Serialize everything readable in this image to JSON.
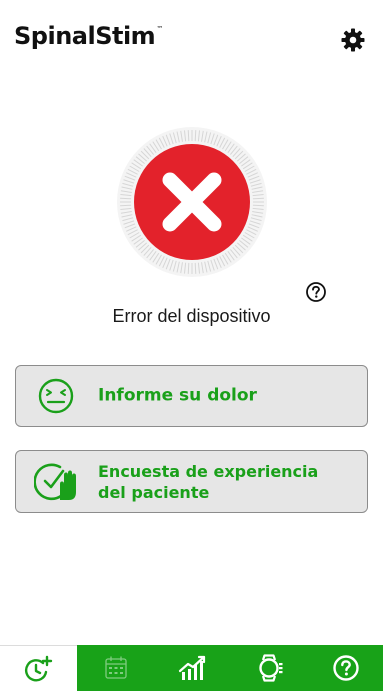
{
  "header": {
    "app_name": "SpinalStim",
    "trademark": "™",
    "settings_icon": "gear-icon"
  },
  "status": {
    "icon": "error-x-icon",
    "caption": "Error del dispositivo",
    "help_icon": "question-circle-icon",
    "colors": {
      "error_red": "#e3222b",
      "ring": "#dddddd"
    }
  },
  "actions": [
    {
      "label": "Informe su dolor",
      "icon": "pain-face-icon"
    },
    {
      "label_line1": "Encuesta de experiencia",
      "label_line2": "del paciente",
      "icon": "survey-check-hand-icon"
    }
  ],
  "tabbar": {
    "tabs": [
      {
        "icon": "therapy-clock-add-icon",
        "active": true
      },
      {
        "icon": "calendar-icon",
        "active": false
      },
      {
        "icon": "progress-chart-icon",
        "active": false
      },
      {
        "icon": "watch-device-icon",
        "active": false
      },
      {
        "icon": "help-circle-icon",
        "active": false
      }
    ],
    "colors": {
      "accent": "#18a218",
      "active_bg": "#ffffff"
    }
  }
}
